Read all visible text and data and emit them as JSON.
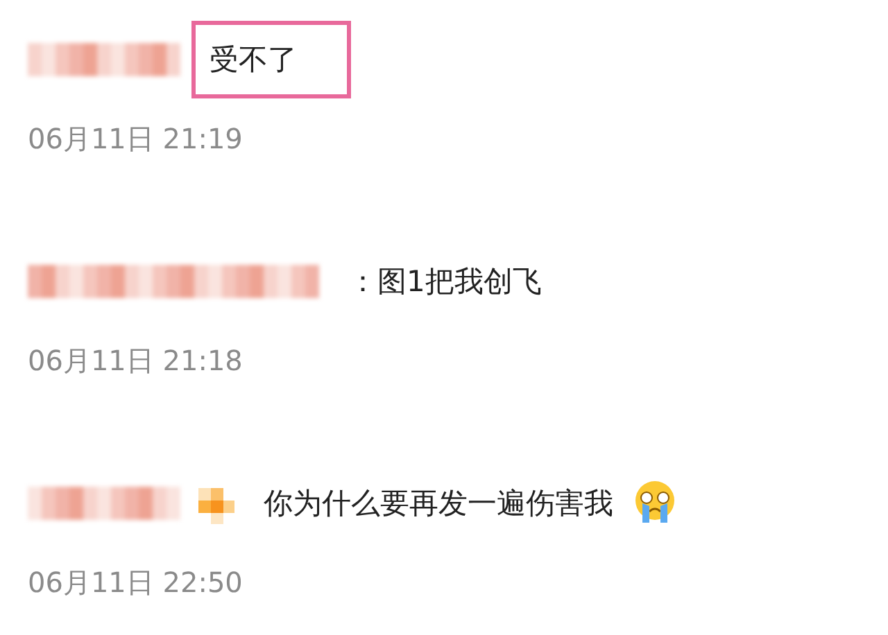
{
  "comments": [
    {
      "text": "受不了",
      "time": "06月11日 21:19",
      "highlighted": true,
      "badge": false,
      "emoji": false
    },
    {
      "text": "：图1把我创飞",
      "time": "06月11日 21:18",
      "highlighted": false,
      "badge": false,
      "emoji": false
    },
    {
      "text": "你为什么要再发一遍伤害我",
      "time": "06月11日 22:50",
      "highlighted": false,
      "badge": true,
      "emoji": true
    }
  ]
}
